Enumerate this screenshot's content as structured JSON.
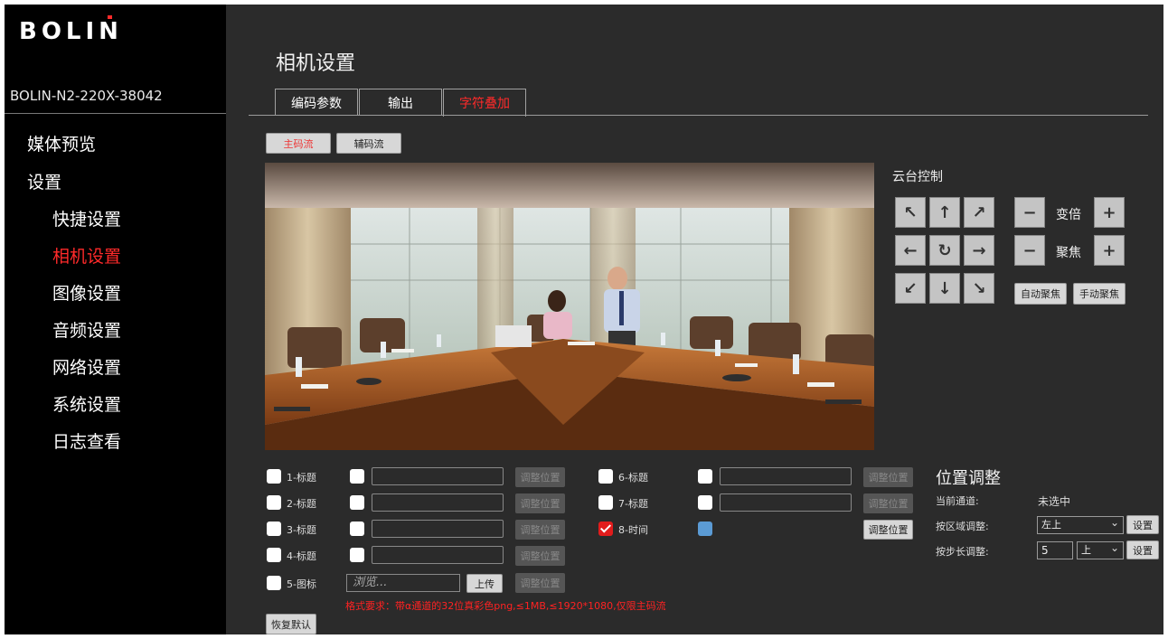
{
  "brand": {
    "logo_text": "BOLIN",
    "accent": "#ff2a2a"
  },
  "device_name": "BOLIN-N2-220X-38042",
  "nav": {
    "media_preview": "媒体预览",
    "settings": "设置",
    "items": [
      "快捷设置",
      "相机设置",
      "图像设置",
      "音频设置",
      "网络设置",
      "系统设置",
      "日志查看"
    ],
    "active": "相机设置"
  },
  "page_title": "相机设置",
  "tabs": [
    "编码参数",
    "输出",
    "字符叠加"
  ],
  "active_tab": "字符叠加",
  "streams": {
    "main": "主码流",
    "sub": "辅码流"
  },
  "ptz": {
    "title": "云台控制",
    "arrows": [
      "↖",
      "↑",
      "↗",
      "←",
      "↻",
      "→",
      "↙",
      "↓",
      "↘"
    ],
    "zoom_label": "变倍",
    "focus_label": "聚焦",
    "minus": "−",
    "plus": "+",
    "auto_focus": "自动聚焦",
    "manual_focus": "手动聚焦"
  },
  "osd": {
    "rows_left": [
      {
        "label": "1-标题",
        "checked": false
      },
      {
        "label": "2-标题",
        "checked": false
      },
      {
        "label": "3-标题",
        "checked": false
      },
      {
        "label": "4-标题",
        "checked": false
      },
      {
        "label": "5-图标",
        "checked": false
      }
    ],
    "rows_right": [
      {
        "label": "6-标题",
        "checked": false
      },
      {
        "label": "7-标题",
        "checked": false
      },
      {
        "label": "8-时间",
        "checked": true
      }
    ],
    "adjust_button": "调整位置",
    "browse_placeholder": "浏览...",
    "upload_button": "上传",
    "format_note": "格式要求：带α通道的32位真彩色png,≤1MB,≤1920*1080,仅限主码流",
    "restore_default": "恢复默认"
  },
  "position": {
    "title": "位置调整",
    "current_channel_label": "当前通道:",
    "current_channel_value": "未选中",
    "by_area_label": "按区域调整:",
    "area_value": "左上",
    "by_step_label": "按步长调整:",
    "step_value": "5",
    "direction_value": "上",
    "set_button": "设置"
  }
}
